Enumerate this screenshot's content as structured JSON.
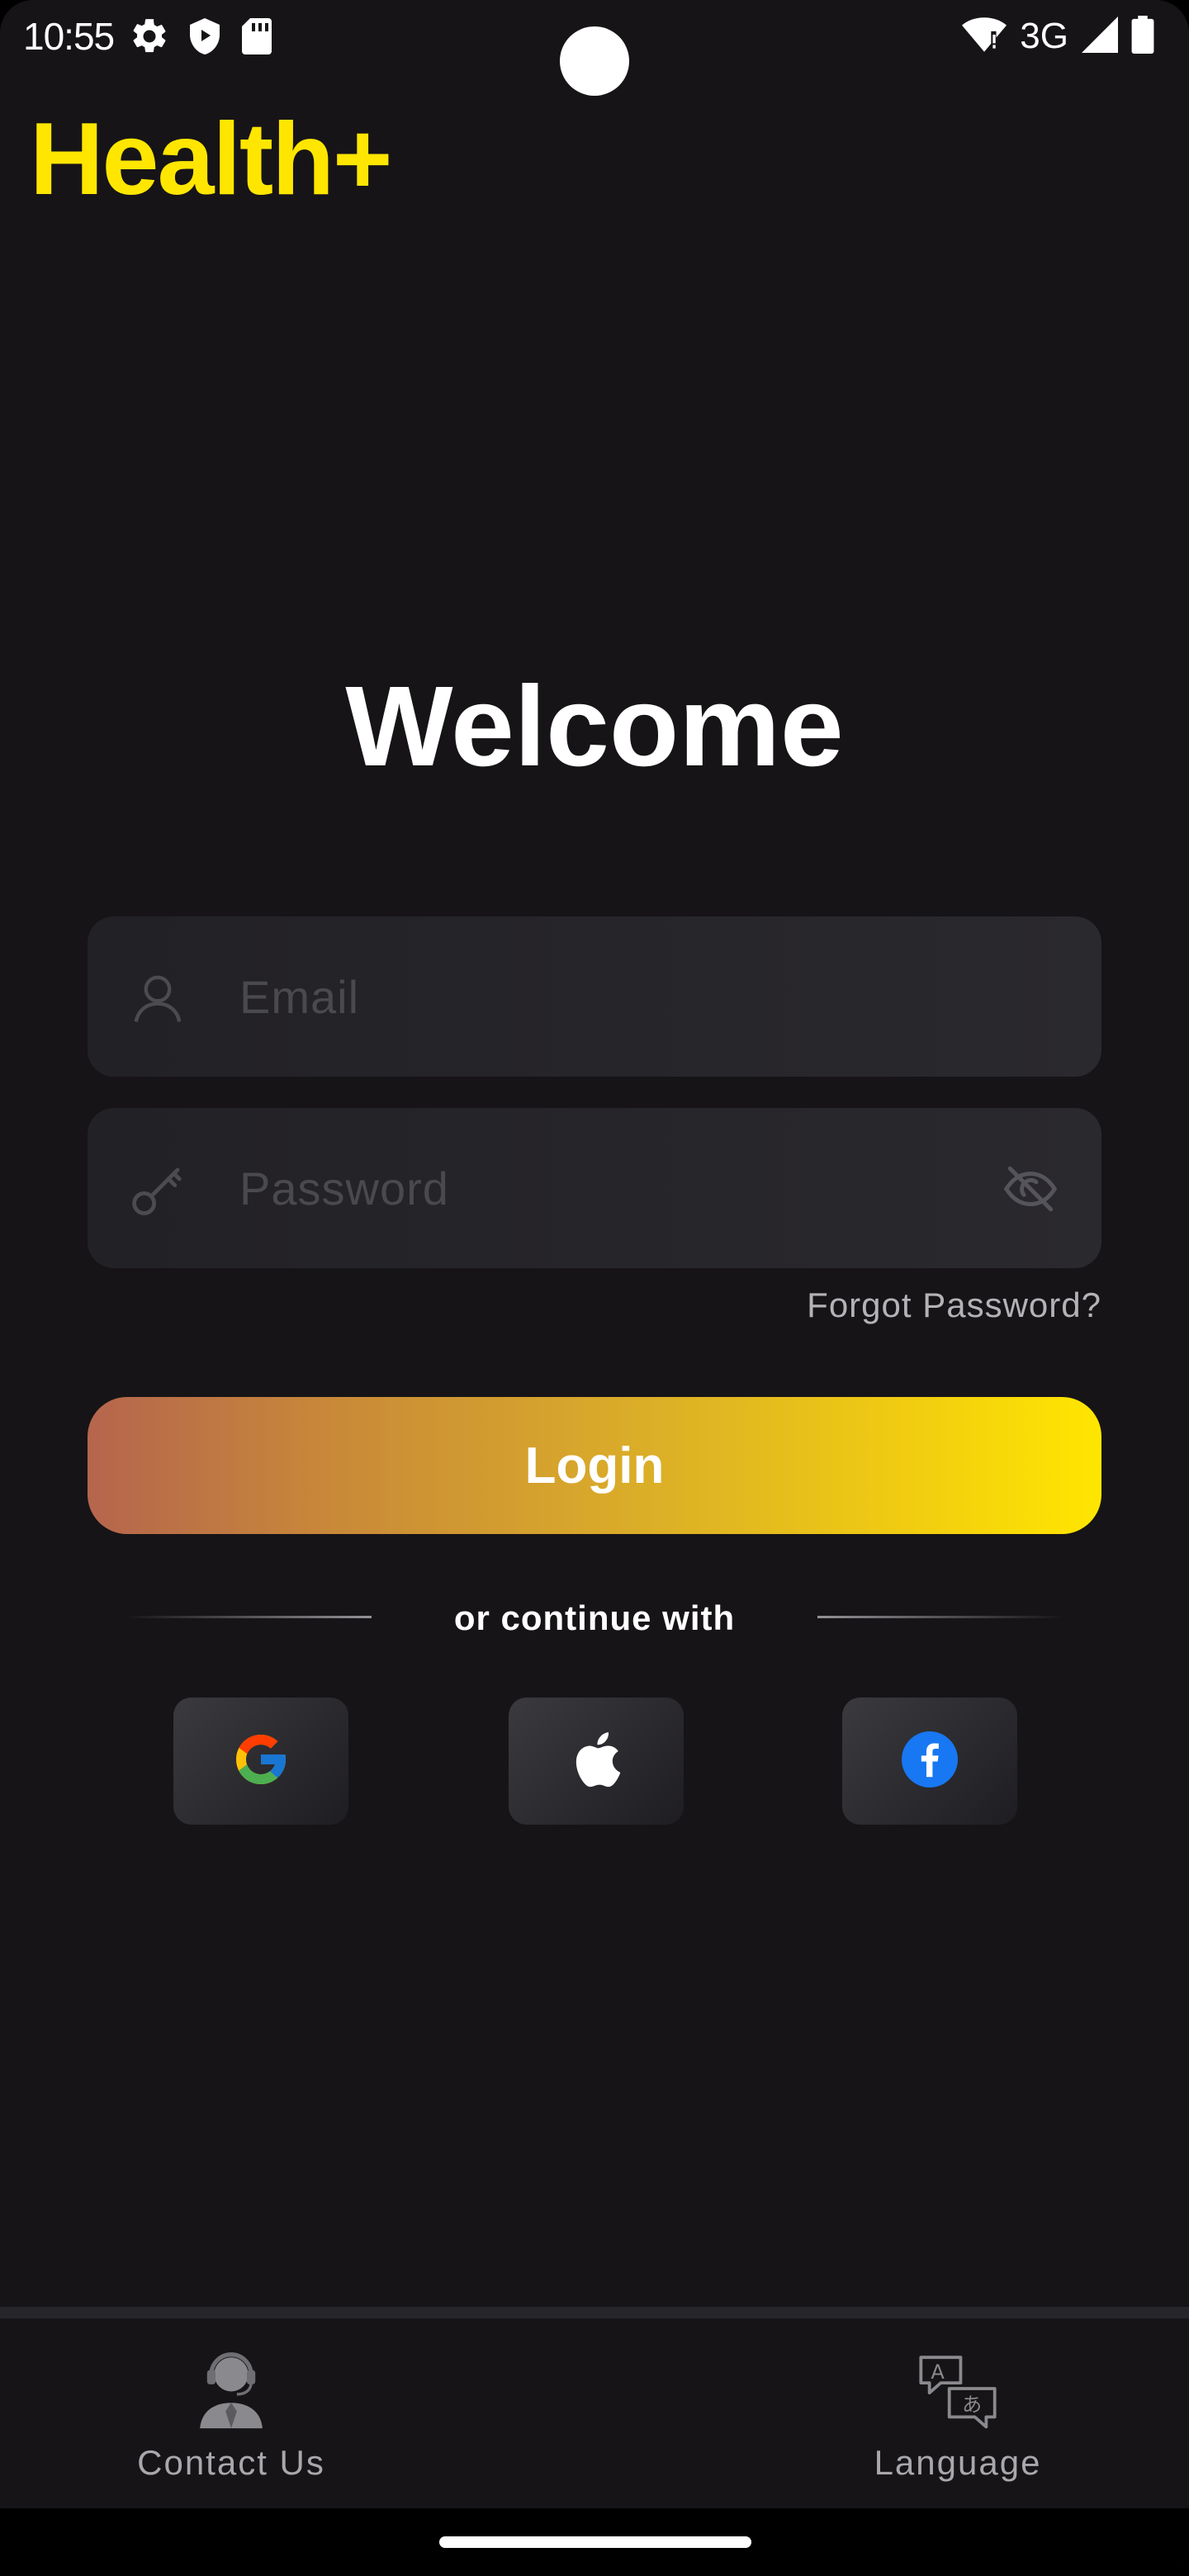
{
  "status_bar": {
    "time": "10:55",
    "network": "3G",
    "left_icons": [
      "gear-icon",
      "shield-play-icon",
      "sd-card-icon"
    ],
    "right_icons": [
      "wifi-icon",
      "signal-icon",
      "battery-icon"
    ]
  },
  "app": {
    "brand": "Health+",
    "brand_color": "#FFE600"
  },
  "login": {
    "title": "Welcome",
    "email_placeholder": "Email",
    "password_placeholder": "Password",
    "forgot_password": "Forgot Password?",
    "login_button": "Login",
    "continue_with": "or continue with",
    "social_providers": [
      "Google",
      "Apple",
      "Facebook"
    ]
  },
  "bottom_bar": {
    "contact_label": "Contact Us",
    "language_label": "Language"
  },
  "colors": {
    "background": "#161417",
    "field": "#242327",
    "gradient_start": "#B5654D",
    "gradient_end": "#FFE600"
  }
}
